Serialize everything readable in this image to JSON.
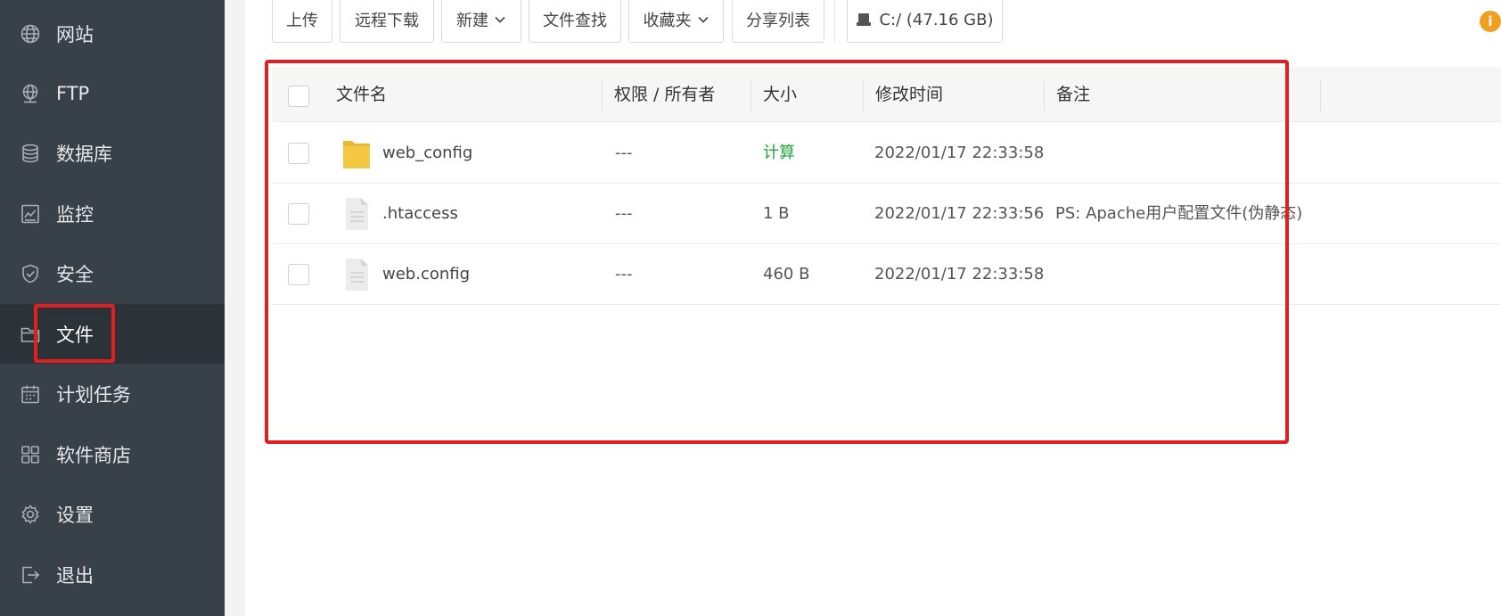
{
  "sidebar": {
    "items": [
      {
        "label": "网站",
        "icon": "globe-icon"
      },
      {
        "label": "FTP",
        "icon": "ftp-icon"
      },
      {
        "label": "数据库",
        "icon": "database-icon"
      },
      {
        "label": "监控",
        "icon": "monitor-icon"
      },
      {
        "label": "安全",
        "icon": "shield-icon"
      },
      {
        "label": "文件",
        "icon": "folder-icon",
        "active": true
      },
      {
        "label": "计划任务",
        "icon": "calendar-icon"
      },
      {
        "label": "软件商店",
        "icon": "grid-icon"
      },
      {
        "label": "设置",
        "icon": "gear-icon"
      },
      {
        "label": "退出",
        "icon": "logout-icon"
      }
    ]
  },
  "toolbar": {
    "upload": "上传",
    "remote_download": "远程下载",
    "new": "新建",
    "file_search": "文件查找",
    "favorites": "收藏夹",
    "share_list": "分享列表",
    "disk": "C:/ (47.16 GB)"
  },
  "table": {
    "headers": {
      "name": "文件名",
      "permission": "权限 / 所有者",
      "size": "大小",
      "modified": "修改时间",
      "remark": "备注"
    },
    "rows": [
      {
        "name": "web_config",
        "type": "folder",
        "permission": "---",
        "size": "计算",
        "modified": "2022/01/17 22:33:58",
        "remark": ""
      },
      {
        "name": ".htaccess",
        "type": "file",
        "permission": "---",
        "size": "1 B",
        "modified": "2022/01/17 22:33:56",
        "remark": "PS: Apache用户配置文件(伪静态)"
      },
      {
        "name": "web.config",
        "type": "file",
        "permission": "---",
        "size": "460 B",
        "modified": "2022/01/17 22:33:58",
        "remark": ""
      }
    ]
  },
  "colors": {
    "sidebar_bg": "#384148",
    "sidebar_active_bg": "#2b3238",
    "highlight_red": "#e02020",
    "size_link_green": "#20a53a",
    "info_orange": "#f0a020",
    "folder_yellow": "#f5c842"
  }
}
